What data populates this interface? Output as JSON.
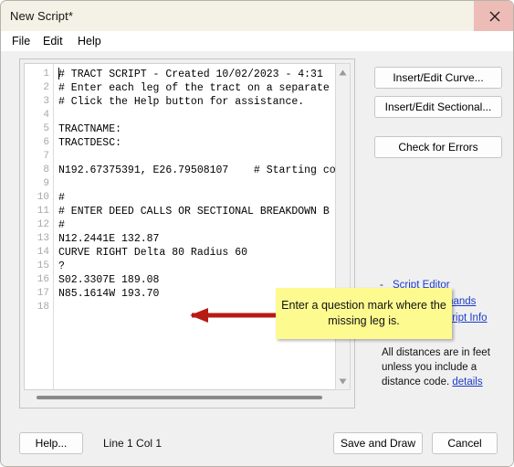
{
  "window": {
    "title": "New Script*",
    "close_icon": "close-icon"
  },
  "menubar": {
    "items": [
      {
        "label": "File"
      },
      {
        "label": "Edit"
      },
      {
        "label": "Help"
      }
    ]
  },
  "editor": {
    "line_numbers": [
      "1",
      "2",
      "3",
      "4",
      "5",
      "6",
      "7",
      "8",
      "9",
      "10",
      "11",
      "12",
      "13",
      "14",
      "15",
      "16",
      "17",
      "18"
    ],
    "lines": [
      "# TRACT SCRIPT - Created 10/02/2023 - 4:31",
      "# Enter each leg of the tract on a separate",
      "# Click the Help button for assistance.",
      "",
      "TRACTNAME:",
      "TRACTDESC:",
      "",
      "N192.67375391, E26.79508107    # Starting co",
      "",
      "#",
      "# ENTER DEED CALLS OR SECTIONAL BREAKDOWN B",
      "#",
      "N12.2441E 132.87",
      "CURVE RIGHT Delta 80 Radius 60",
      "?",
      "S02.3307E 189.08",
      "N85.1614W 193.70",
      ""
    ],
    "scroll_up_icon": "scroll-up-arrow-icon",
    "scroll_down_icon": "scroll-down-arrow-icon"
  },
  "right_panel": {
    "insert_edit_curve": "Insert/Edit Curve...",
    "insert_edit_sectional": "Insert/Edit Sectional...",
    "check_for_errors": "Check for Errors",
    "links": [
      {
        "dash": "-",
        "label": "Script Editor"
      },
      {
        "dash": "-",
        "label": "Script Commands"
      },
      {
        "dash": "-",
        "label": "Important Script Info"
      }
    ],
    "note_text": "All distances are in feet unless you include a distance code.",
    "note_link": "details"
  },
  "callout": {
    "text": "Enter a question mark where the missing leg is.",
    "background": "#fdfa90",
    "arrow_color": "#b61c14"
  },
  "footer": {
    "help": "Help...",
    "status": "Line 1 Col 1",
    "save_and_draw": "Save and Draw",
    "cancel": "Cancel"
  }
}
